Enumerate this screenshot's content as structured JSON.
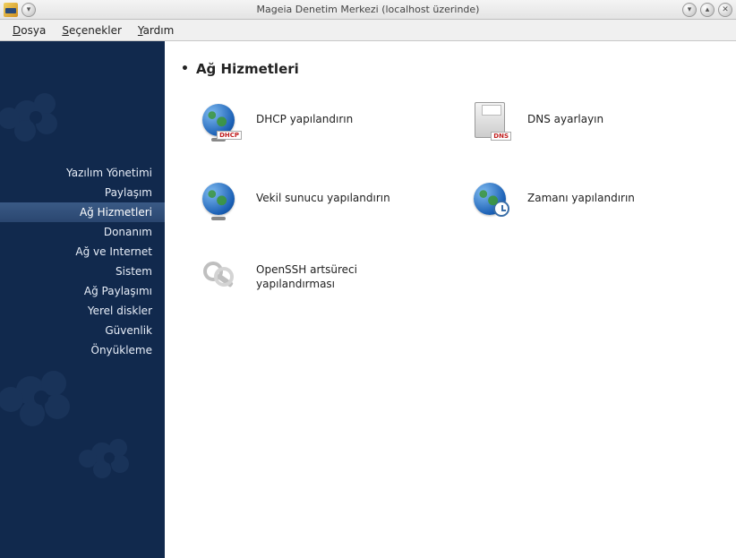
{
  "window": {
    "title": "Mageia Denetim Merkezi  (localhost üzerinde)"
  },
  "menu": {
    "file": "Dosya",
    "options": "Seçenekler",
    "help": "Yardım"
  },
  "sidebar": {
    "items": [
      {
        "label": "Yazılım Yönetimi"
      },
      {
        "label": "Paylaşım"
      },
      {
        "label": "Ağ Hizmetleri"
      },
      {
        "label": "Donanım"
      },
      {
        "label": "Ağ ve Internet"
      },
      {
        "label": "Sistem"
      },
      {
        "label": "Ağ Paylaşımı"
      },
      {
        "label": "Yerel diskler"
      },
      {
        "label": "Güvenlik"
      },
      {
        "label": "Önyükleme"
      }
    ],
    "active_index": 2
  },
  "content": {
    "heading": "Ağ Hizmetleri",
    "tiles": {
      "dhcp": "DHCP yapılandırın",
      "dns": "DNS ayarlayın",
      "proxy": "Vekil sunucu yapılandırın",
      "time": "Zamanı yapılandırın",
      "ssh": "OpenSSH artsüreci yapılandırması"
    },
    "icon_badges": {
      "dhcp": "DHCP",
      "dns": "DNS"
    }
  }
}
